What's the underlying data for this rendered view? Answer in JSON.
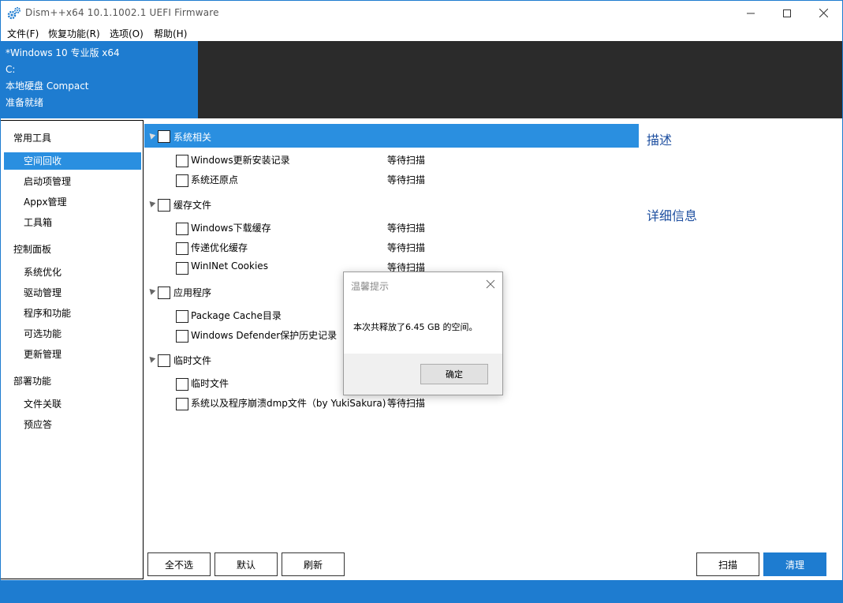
{
  "window": {
    "title": "Dism++x64 10.1.1002.1 UEFI Firmware"
  },
  "menu": [
    "文件(F)",
    "恢复功能(R)",
    "选项(O)",
    "帮助(H)"
  ],
  "header": {
    "line1": "*Windows 10 专业版 x64",
    "line2": "C:",
    "line3": "本地硬盘 Compact",
    "line4": "准备就绪"
  },
  "sidebar": {
    "group_tools": "常用工具",
    "tools": [
      "空间回收",
      "启动项管理",
      "Appx管理",
      "工具箱"
    ],
    "group_control": "控制面板",
    "control": [
      "系统优化",
      "驱动管理",
      "程序和功能",
      "可选功能",
      "更新管理"
    ],
    "group_deploy": "部署功能",
    "deploy": [
      "文件关联",
      "预应答"
    ]
  },
  "categories": [
    {
      "label": "系统相关",
      "items": [
        {
          "label": "Windows更新安装记录",
          "status": "等待扫描"
        },
        {
          "label": "系统还原点",
          "status": "等待扫描"
        }
      ]
    },
    {
      "label": "缓存文件",
      "items": [
        {
          "label": "Windows下载缓存",
          "status": "等待扫描"
        },
        {
          "label": "传递优化缓存",
          "status": "等待扫描"
        },
        {
          "label": "WinINet Cookies",
          "status": "等待扫描"
        }
      ]
    },
    {
      "label": "应用程序",
      "items": [
        {
          "label": "Package Cache目录",
          "status": ""
        },
        {
          "label": "Windows Defender保护历史记录",
          "status": ""
        }
      ]
    },
    {
      "label": "临时文件",
      "items": [
        {
          "label": "临时文件",
          "status": ""
        },
        {
          "label": "系统以及程序崩溃dmp文件（by YukiSakura)",
          "status": "等待扫描"
        }
      ]
    }
  ],
  "panel": {
    "description_title": "描述",
    "detail_title": "详细信息"
  },
  "buttons": {
    "deselect_all": "全不选",
    "default": "默认",
    "refresh": "刷新",
    "scan": "扫描",
    "clean": "清理"
  },
  "dialog": {
    "title": "温馨提示",
    "message": "本次共释放了6.45 GB 的空间。",
    "ok": "确定"
  },
  "colors": {
    "accent": "#1e7cd0",
    "selected": "#2a8fe0",
    "header_dark": "#2b2b2b"
  }
}
